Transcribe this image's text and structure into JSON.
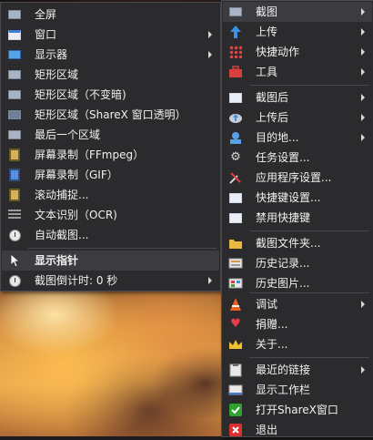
{
  "left_menu": {
    "items": [
      {
        "label": "全屏",
        "icon": "fullscreen-icon",
        "submenu": false
      },
      {
        "label": "窗口",
        "icon": "window-icon",
        "submenu": true
      },
      {
        "label": "显示器",
        "icon": "monitor-icon",
        "submenu": true
      },
      {
        "label": "矩形区域",
        "icon": "rectangle-region-icon",
        "submenu": false
      },
      {
        "label": "矩形区域（不变暗)",
        "icon": "rectangle-light-icon",
        "submenu": false
      },
      {
        "label": "矩形区域（ShareX 窗口透明）",
        "icon": "rectangle-transparent-icon",
        "submenu": false
      },
      {
        "label": "最后一个区域",
        "icon": "last-region-icon",
        "submenu": false
      },
      {
        "label": "屏幕录制（FFmpeg）",
        "icon": "screen-record-ffmpeg-icon",
        "submenu": false
      },
      {
        "label": "屏幕录制（GIF）",
        "icon": "screen-record-gif-icon",
        "submenu": false
      },
      {
        "label": "滚动捕捉...",
        "icon": "scrolling-capture-icon",
        "submenu": false
      },
      {
        "label": "文本识别（OCR)",
        "icon": "ocr-icon",
        "submenu": false
      },
      {
        "label": "自动截图...",
        "icon": "auto-capture-icon",
        "submenu": false
      }
    ],
    "show_cursor_label": "显示指针",
    "delay_label": "截图倒计时: 0 秒"
  },
  "right_menu": {
    "items": [
      {
        "label": "截图",
        "icon": "capture-icon",
        "submenu": true
      },
      {
        "label": "上传",
        "icon": "upload-arrow-icon",
        "submenu": true
      },
      {
        "label": "快捷动作",
        "icon": "quick-actions-icon",
        "submenu": true
      },
      {
        "label": "工具",
        "icon": "toolbox-icon",
        "submenu": true
      },
      {
        "label": "截图后",
        "icon": "after-capture-icon",
        "submenu": true
      },
      {
        "label": "上传后",
        "icon": "after-upload-icon",
        "submenu": true
      },
      {
        "label": "目的地...",
        "icon": "destinations-icon",
        "submenu": true
      },
      {
        "label": "任务设置...",
        "icon": "gear-icon",
        "submenu": false
      },
      {
        "label": "应用程序设置...",
        "icon": "wrench-icon",
        "submenu": false
      },
      {
        "label": "快捷键设置...",
        "icon": "hotkey-icon",
        "submenu": false
      },
      {
        "label": "禁用快捷键",
        "icon": "disable-hotkey-icon",
        "submenu": false
      },
      {
        "label": "截图文件夹...",
        "icon": "folder-icon",
        "submenu": false
      },
      {
        "label": "历史记录...",
        "icon": "history-icon",
        "submenu": false
      },
      {
        "label": "历史图片...",
        "icon": "image-history-icon",
        "submenu": false
      },
      {
        "label": "调试",
        "icon": "debug-icon",
        "submenu": true
      },
      {
        "label": "捐赠...",
        "icon": "heart-icon",
        "submenu": false
      },
      {
        "label": "关于...",
        "icon": "crown-icon",
        "submenu": false
      },
      {
        "label": "最近的链接",
        "icon": "clipboard-icon",
        "submenu": true
      },
      {
        "label": "显示工作栏",
        "icon": "taskbar-icon",
        "submenu": false
      },
      {
        "label": "打开ShareX窗口",
        "icon": "checkmark-icon",
        "submenu": false
      },
      {
        "label": "退出",
        "icon": "close-icon",
        "submenu": false
      }
    ]
  },
  "colors": {
    "menu_bg": "#2b2b2e",
    "highlight": "#3c3c40",
    "text": "#f0f0f0"
  }
}
